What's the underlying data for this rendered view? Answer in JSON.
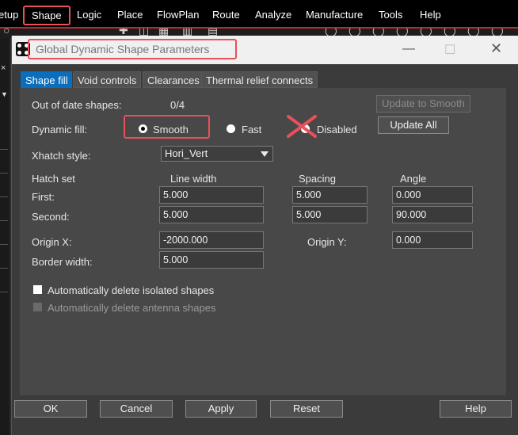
{
  "menu": {
    "items": [
      "etup",
      "Shape",
      "Logic",
      "Place",
      "FlowPlan",
      "Route",
      "Analyze",
      "Manufacture",
      "Tools",
      "Help"
    ],
    "active": "Shape"
  },
  "dialog": {
    "title": "Global Dynamic Shape Parameters",
    "tabs": [
      "Shape fill",
      "Void controls",
      "Clearances",
      "Thermal relief connects"
    ],
    "active_tab": "Shape fill",
    "out_of_date_label": "Out of date shapes:",
    "out_of_date_value": "0/4",
    "update_to_smooth_label": "Update to Smooth",
    "dynamic_fill_label": "Dynamic fill:",
    "fill_options": [
      "Smooth",
      "Fast",
      "Disabled"
    ],
    "fill_selected": "Smooth",
    "update_all_label": "Update All",
    "xhatch_label": "Xhatch style:",
    "xhatch_value": "Hori_Vert",
    "hatch_set_label": "Hatch set",
    "line_width_label": "Line width",
    "spacing_label": "Spacing",
    "angle_label": "Angle",
    "first_label": "First:",
    "second_label": "Second:",
    "first_line_width": "5.000",
    "first_spacing": "5.000",
    "first_angle": "0.000",
    "second_line_width": "5.000",
    "second_spacing": "5.000",
    "second_angle": "90.000",
    "origin_x_label": "Origin X:",
    "origin_x_value": "-2000.000",
    "origin_y_label": "Origin Y:",
    "origin_y_value": "0.000",
    "border_width_label": "Border width:",
    "border_width_value": "5.000",
    "auto_delete_isolated_label": "Automatically delete isolated shapes",
    "auto_delete_antenna_label": "Automatically delete antenna shapes",
    "ok_label": "OK",
    "cancel_label": "Cancel",
    "apply_label": "Apply",
    "reset_label": "Reset",
    "help_label": "Help"
  },
  "colors": {
    "highlight": "#e8505b",
    "tab_active": "#0a6ebd",
    "menubar_accent": "#c0282d"
  },
  "icons": [
    "app-icon",
    "minimize-icon",
    "maximize-icon",
    "close-icon",
    "cross-mark-icon",
    "dropdown-arrow-icon"
  ]
}
